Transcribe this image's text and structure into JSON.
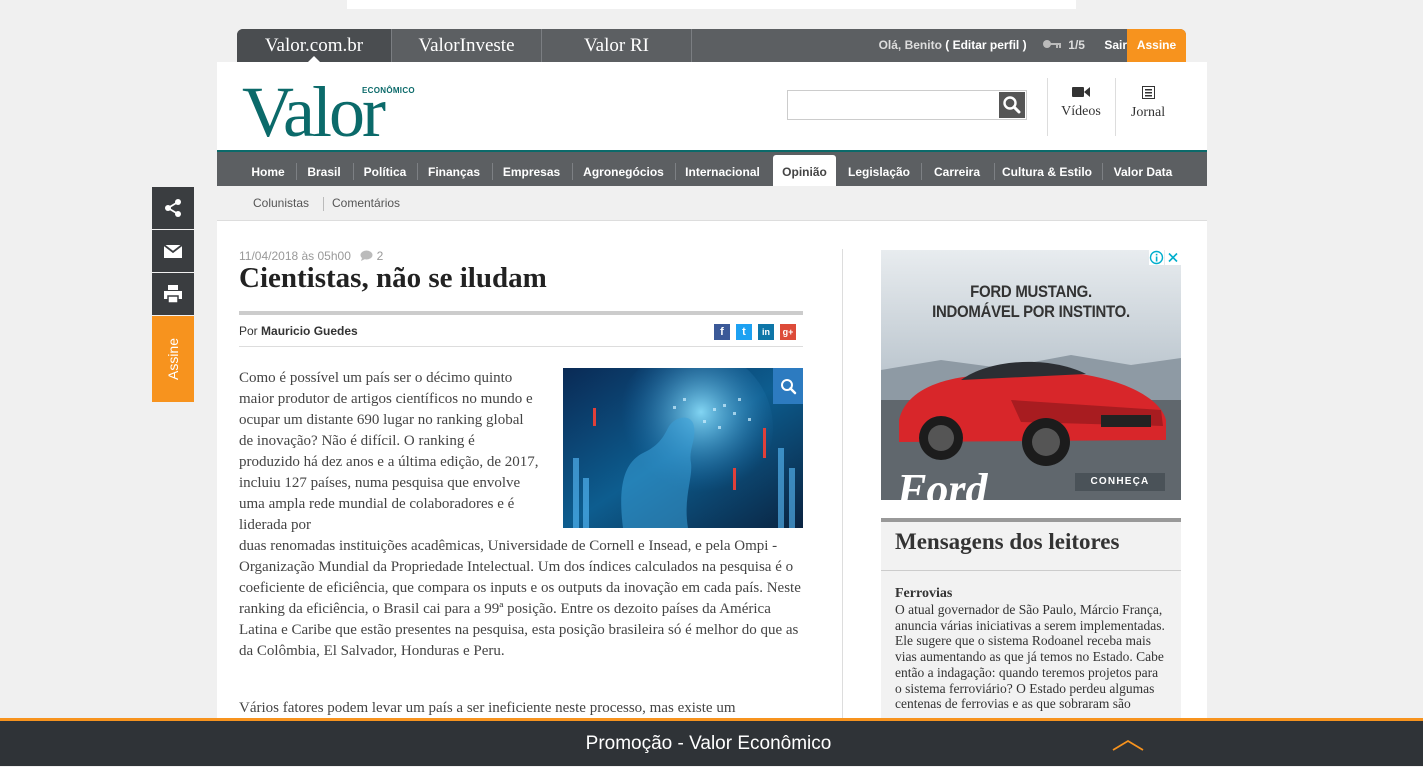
{
  "colors": {
    "accent": "#f7931e",
    "brand_teal": "#0b6a6a",
    "nav_gray": "#5c5f62",
    "dark_bar": "#2f3337"
  },
  "site_tabs": [
    {
      "label": "Valor.com.br"
    },
    {
      "label": "ValorInveste"
    },
    {
      "label": "Valor RI"
    }
  ],
  "user": {
    "greeting": "Olá, Benito",
    "edit_profile": "( Editar perfil )",
    "key_icon": "key-icon",
    "counter": "1/5",
    "logout": "Sair",
    "subscribe": "Assine"
  },
  "logo": {
    "main": "Valor",
    "sub": "ECONÔMICO"
  },
  "search": {
    "value": "",
    "placeholder": "",
    "icon": "search-icon"
  },
  "header_links": {
    "videos": "Vídeos",
    "jornal": "Jornal"
  },
  "nav": [
    {
      "label": "Home"
    },
    {
      "label": "Brasil"
    },
    {
      "label": "Política"
    },
    {
      "label": "Finanças"
    },
    {
      "label": "Empresas"
    },
    {
      "label": "Agronegócios"
    },
    {
      "label": "Internacional"
    },
    {
      "label": "Opinião"
    },
    {
      "label": "Legislação"
    },
    {
      "label": "Carreira"
    },
    {
      "label": "Cultura & Estilo"
    },
    {
      "label": "Valor Data"
    }
  ],
  "subnav": [
    {
      "label": "Colunistas"
    },
    {
      "label": "Comentários"
    }
  ],
  "side_bar": {
    "subscribe": "Assine"
  },
  "article": {
    "date": "11/04/2018 às 05h00",
    "comments": "2",
    "title": "Cientistas, não se iludam",
    "byline_prefix": "Por",
    "author": "Mauricio Guedes",
    "social": [
      "f",
      "t",
      "in",
      "g+"
    ],
    "para1a": "Como é possível um país ser o décimo quinto maior produtor de artigos científicos no mundo e ocupar um distante 690 lugar no ranking global de inovação? Não é difícil. O ranking é produzido há dez anos e a última edição, de 2017, incluiu 127 países, numa pesquisa que envolve uma ampla rede mundial de colaboradores e é liderada por",
    "para1b": "duas renomadas instituições acadêmicas, Universidade de Cornell e Insead, e pela Ompi - Organização Mundial da Propriedade Intelectual. Um dos índices calculados na pesquisa é o coeficiente de eficiência, que compara os inputs e os outputs da inovação em cada país. Neste ranking da eficiência, o Brasil cai para a 99ª posição. Entre os dezoito países da América Latina e Caribe que estão presentes na pesquisa, esta posição brasileira só é melhor do que as da Colômbia, El Salvador, Honduras e Peru.",
    "para2": "Vários fatores podem levar um país a ser ineficiente neste processo, mas existe um"
  },
  "ad": {
    "headline1": "FORD MUSTANG.",
    "headline2": "INDOMÁVEL POR INSTINTO.",
    "cta": "CONHEÇA",
    "brand": "Ford"
  },
  "messages": {
    "title": "Mensagens dos leitores",
    "item_title": "Ferrovias",
    "item_text": "O atual governador de São Paulo, Márcio França, anuncia várias iniciativas a serem implementadas. Ele sugere que o sistema Rodoanel receba mais vias aumentando as que já temos no Estado. Cabe então a indagação: quando teremos projetos para o sistema ferroviário? O Estado perdeu algumas centenas de ferrovias e as que sobraram são"
  },
  "promo": {
    "text": "Promoção - Valor Econômico",
    "icon": "chevron-up-icon"
  }
}
